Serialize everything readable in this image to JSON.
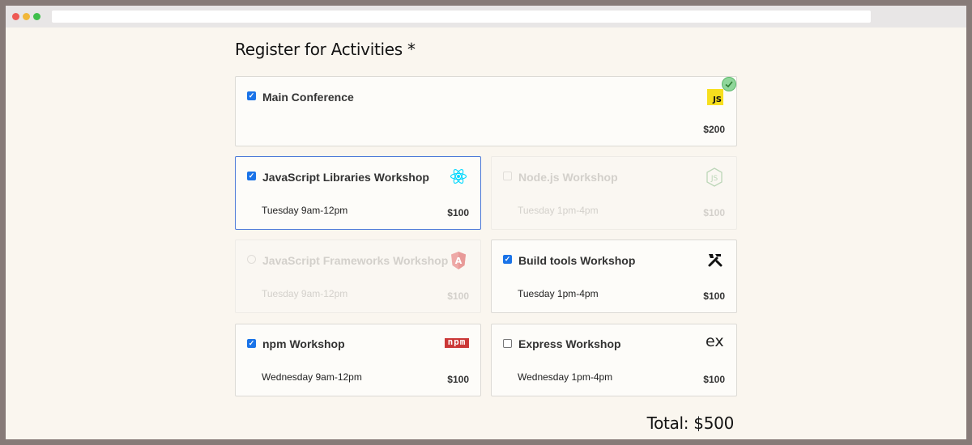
{
  "page": {
    "title": "Register for Activities",
    "required_marker": "*",
    "total": "Total: $500"
  },
  "activities": [
    {
      "name": "Main Conference",
      "time": "",
      "price": "$200",
      "checked": true,
      "disabled": false,
      "icon": "javascript-logo-icon",
      "icon_text": "JS"
    },
    {
      "name": "JavaScript Libraries Workshop",
      "time": "Tuesday 9am-12pm",
      "price": "$100",
      "checked": true,
      "disabled": false,
      "icon": "react-logo-icon"
    },
    {
      "name": "Node.js Workshop",
      "time": "Tuesday 1pm-4pm",
      "price": "$100",
      "checked": false,
      "disabled": true,
      "icon": "nodejs-logo-icon",
      "icon_text": "JS"
    },
    {
      "name": "JavaScript Frameworks Workshop",
      "time": "Tuesday 9am-12pm",
      "price": "$100",
      "checked": false,
      "disabled": true,
      "icon": "angular-logo-icon",
      "icon_text": "A"
    },
    {
      "name": "Build tools Workshop",
      "time": "Tuesday 1pm-4pm",
      "price": "$100",
      "checked": true,
      "disabled": false,
      "icon": "tools-icon"
    },
    {
      "name": "npm Workshop",
      "time": "Wednesday 9am-12pm",
      "price": "$100",
      "checked": true,
      "disabled": false,
      "icon": "npm-logo-icon",
      "icon_text": "npm"
    },
    {
      "name": "Express Workshop",
      "time": "Wednesday 1pm-4pm",
      "price": "$100",
      "checked": false,
      "disabled": false,
      "icon": "express-logo-icon",
      "icon_text": "ex"
    }
  ],
  "colors": {
    "accent": "#1a73e8",
    "focus_border": "#4c79d8",
    "success": "#4caf50",
    "javascript": "#f7df1e",
    "react": "#00d8ff",
    "angular": "#dd1b16",
    "npm": "#cb3837"
  }
}
